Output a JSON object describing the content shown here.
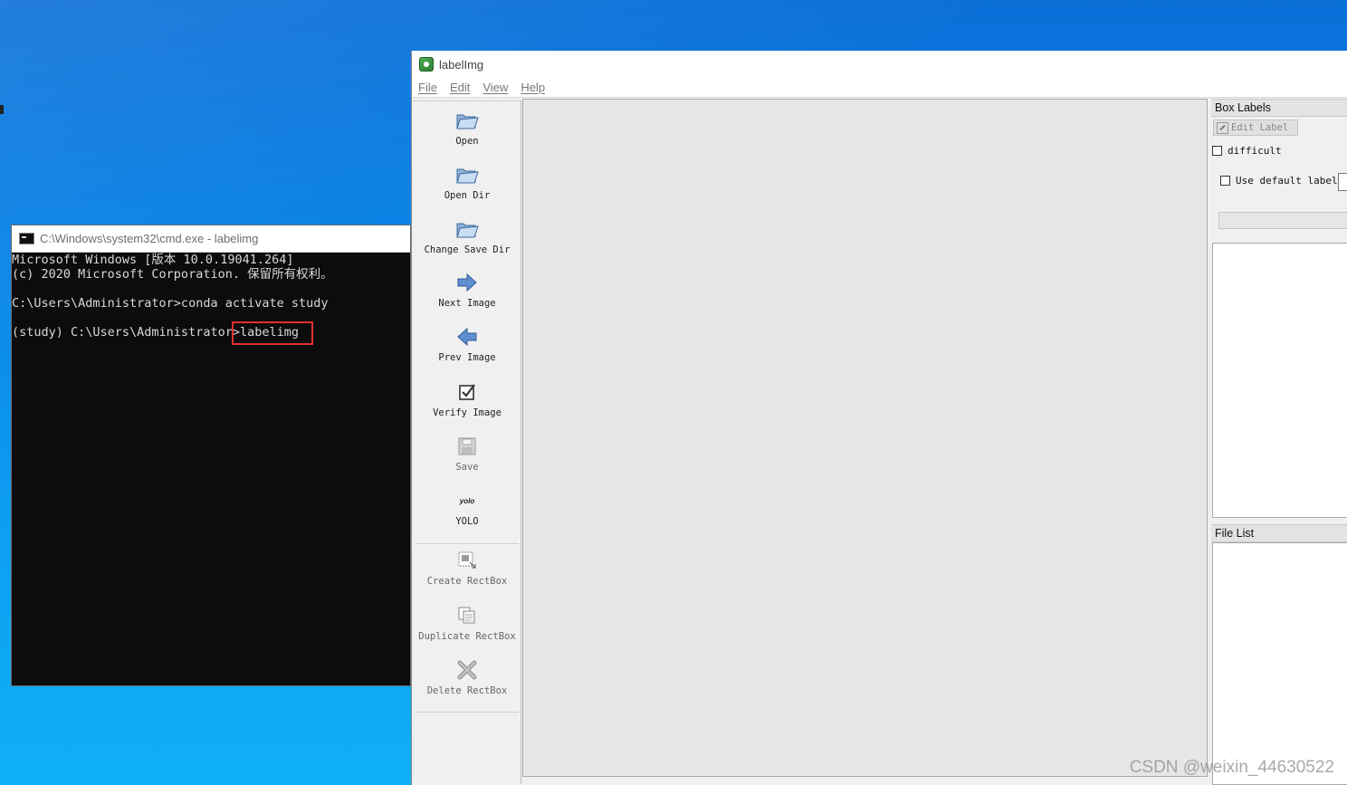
{
  "cmd": {
    "title": "C:\\Windows\\system32\\cmd.exe - labelimg",
    "lines": [
      "Microsoft Windows [版本 10.0.19041.264]",
      "(c) 2020 Microsoft Corporation. 保留所有权利。",
      "",
      "C:\\Users\\Administrator>conda activate study",
      "",
      "(study) C:\\Users\\Administrator>labelimg"
    ],
    "highlight_color": "#e03030"
  },
  "app": {
    "title": "labelImg",
    "menu": [
      "File",
      "Edit",
      "View",
      "Help"
    ],
    "toolbar": [
      {
        "label": "Open",
        "icon": "folder-open-icon"
      },
      {
        "label": "Open Dir",
        "icon": "folder-open-icon"
      },
      {
        "label": "Change Save Dir",
        "icon": "folder-open-icon"
      },
      {
        "label": "Next Image",
        "icon": "arrow-right-icon"
      },
      {
        "label": "Prev Image",
        "icon": "arrow-left-icon"
      },
      {
        "label": "Verify Image",
        "icon": "checkbox-checked-icon"
      },
      {
        "label": "Save",
        "icon": "floppy-disk-icon"
      },
      {
        "label": "YOLO",
        "icon": "yolo-format-icon",
        "icon_text": "yolo"
      },
      {
        "label": "Create RectBox",
        "icon": "create-rectbox-icon"
      },
      {
        "label": "Duplicate RectBox",
        "icon": "duplicate-rectbox-icon"
      },
      {
        "label": "Delete RectBox",
        "icon": "delete-x-icon"
      }
    ],
    "more_indicator": "»",
    "box_labels": {
      "header": "Box Labels",
      "edit_label_button": "Edit Label",
      "difficult_label": "difficult",
      "use_default_label": "Use default label"
    },
    "file_list": {
      "header": "File List"
    }
  },
  "watermark": "CSDN @weixin_44630522",
  "colors": {
    "desktop": "#0a86e8",
    "terminal_bg": "#0c0c0c",
    "canvas_bg": "#e6e6e6"
  }
}
